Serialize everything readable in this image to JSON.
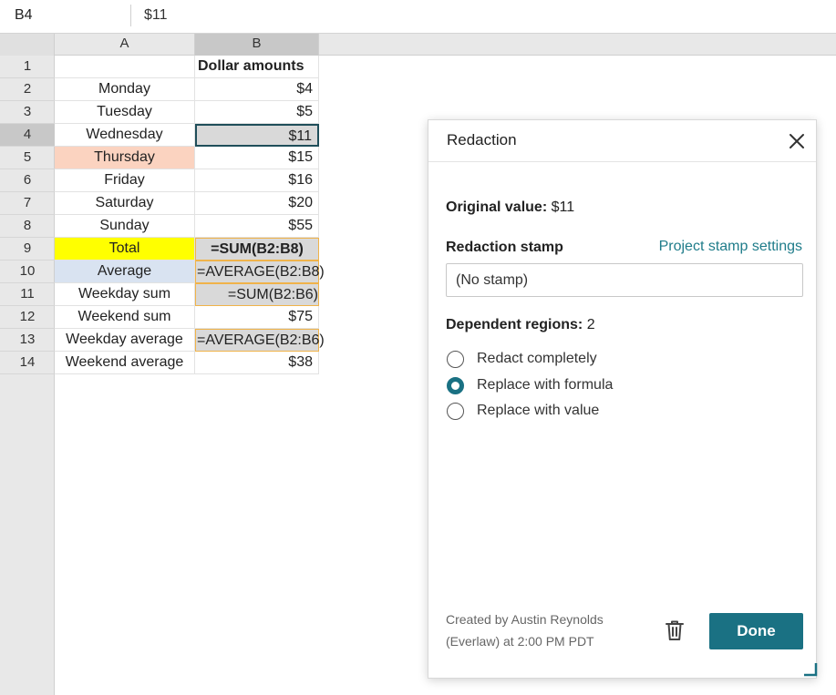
{
  "formula_bar": {
    "name_box": "B4",
    "value": "$11"
  },
  "columns": [
    {
      "label": "A"
    },
    {
      "label": "B"
    }
  ],
  "rows": [
    {
      "num": "1",
      "a": "",
      "b": "Dollar amounts"
    },
    {
      "num": "2",
      "a": "Monday",
      "b": "$4"
    },
    {
      "num": "3",
      "a": "Tuesday",
      "b": "$5"
    },
    {
      "num": "4",
      "a": "Wednesday",
      "b": "$11"
    },
    {
      "num": "5",
      "a": "Thursday",
      "b": "$15"
    },
    {
      "num": "6",
      "a": "Friday",
      "b": "$16"
    },
    {
      "num": "7",
      "a": "Saturday",
      "b": "$20"
    },
    {
      "num": "8",
      "a": "Sunday",
      "b": "$55"
    },
    {
      "num": "9",
      "a": "Total",
      "b": "=SUM(B2:B8)"
    },
    {
      "num": "10",
      "a": "Average",
      "b": "=AVERAGE(B2:B8)"
    },
    {
      "num": "11",
      "a": "Weekday sum",
      "b": "=SUM(B2:B6)"
    },
    {
      "num": "12",
      "a": "Weekend sum",
      "b": "$75"
    },
    {
      "num": "13",
      "a": "Weekday average",
      "b": "=AVERAGE(B2:B6)"
    },
    {
      "num": "14",
      "a": "Weekend average",
      "b": "$38"
    }
  ],
  "colors": {
    "thursday_fill": "#fbd3c0",
    "total_fill": "#ffff00",
    "average_fill": "#d9e3f1",
    "selected_fill": "#d9d9d9",
    "formula_border": "#f0b34a",
    "accent": "#1a7183",
    "link": "#1f7c8a"
  },
  "dialog": {
    "title": "Redaction",
    "close_icon": "close-icon",
    "original_label": "Original value:",
    "original_value": "$11",
    "stamp_label": "Redaction stamp",
    "stamp_link": "Project stamp settings",
    "stamp_value": "(No stamp)",
    "dependent_label": "Dependent regions:",
    "dependent_count": "2",
    "options": [
      {
        "label": "Redact completely",
        "checked": false
      },
      {
        "label": "Replace with formula",
        "checked": true
      },
      {
        "label": "Replace with value",
        "checked": false
      }
    ],
    "created_line1": "Created by Austin Reynolds",
    "created_line2": "(Everlaw) at 2:00 PM PDT",
    "trash_icon": "trash-icon",
    "done_label": "Done"
  }
}
